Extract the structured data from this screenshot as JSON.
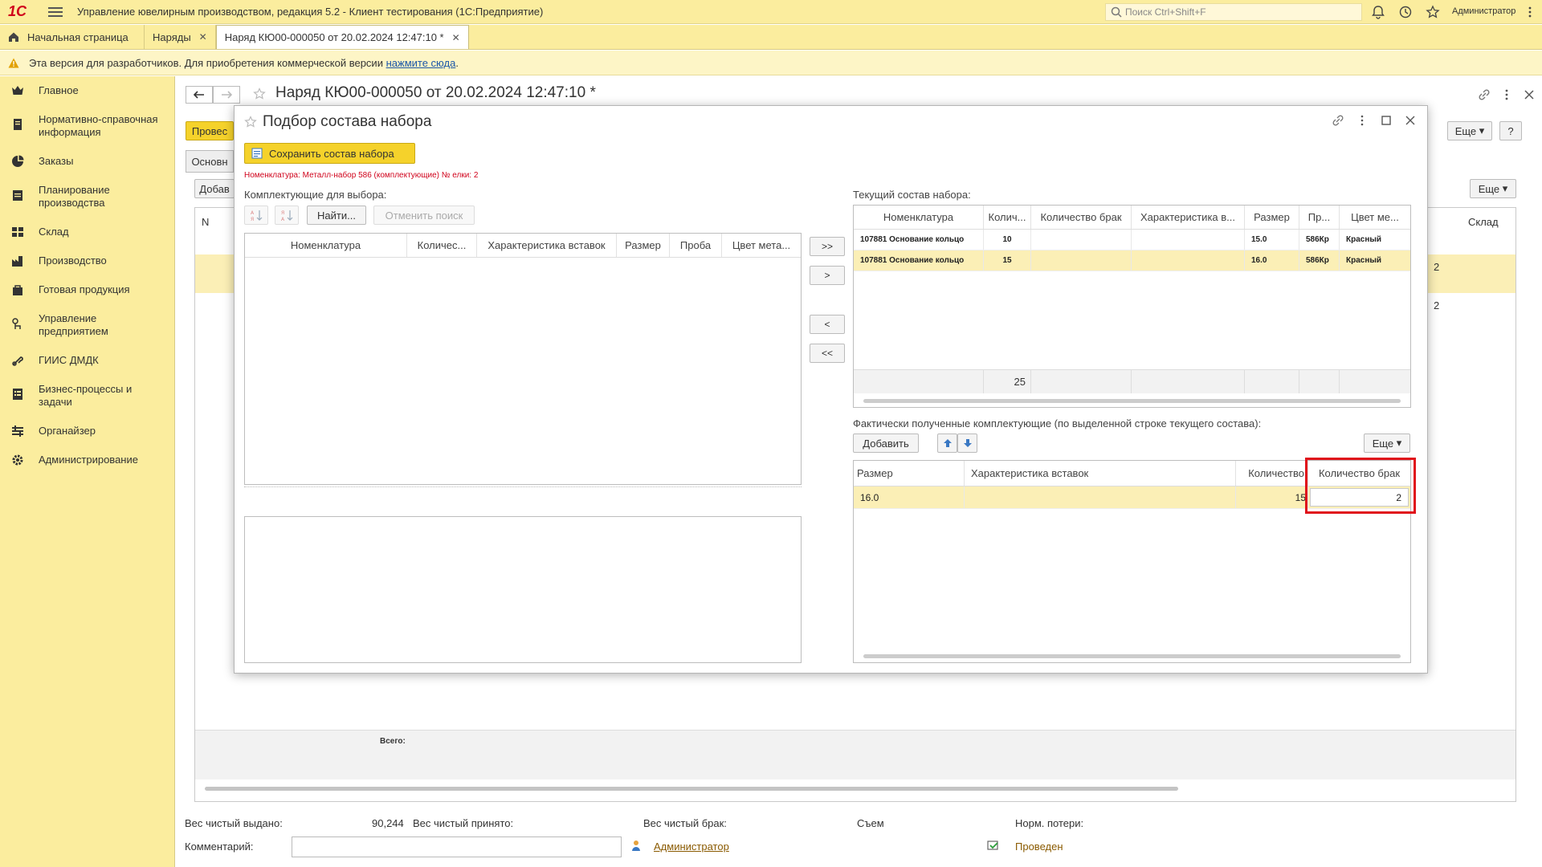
{
  "titlebar": {
    "app_title": "Управление ювелирным производством, редакция 5.2  - Клиент тестирования (1С:Предприятие)",
    "logo_text": "1С",
    "search_placeholder": "Поиск Ctrl+Shift+F",
    "user": "Администратор"
  },
  "tabs": {
    "home": "Начальная страница",
    "naryady": "Наряды",
    "active": "Наряд КЮ00-000050 от 20.02.2024 12:47:10 *"
  },
  "warning": {
    "text": "Эта версия для разработчиков. Для приобретения коммерческой версии ",
    "link": "нажмите сюда",
    "after": "."
  },
  "sidebar": {
    "items": [
      {
        "label": "Главное",
        "icon": "crown-icon"
      },
      {
        "label": "Нормативно-справочная информация",
        "icon": "reference-icon"
      },
      {
        "label": "Заказы",
        "icon": "orders-pie-icon"
      },
      {
        "label": "Планирование производства",
        "icon": "planning-icon"
      },
      {
        "label": "Склад",
        "icon": "warehouse-icon"
      },
      {
        "label": "Производство",
        "icon": "production-icon"
      },
      {
        "label": "Готовая продукция",
        "icon": "finished-goods-icon"
      },
      {
        "label": "Управление предприятием",
        "icon": "enterprise-icon"
      },
      {
        "label": "ГИИС ДМДК",
        "icon": "giis-icon"
      },
      {
        "label": "Бизнес-процессы и задачи",
        "icon": "business-process-icon"
      },
      {
        "label": "Органайзер",
        "icon": "organizer-icon"
      },
      {
        "label": "Администрирование",
        "icon": "admin-gear-icon"
      }
    ]
  },
  "document": {
    "title": "Наряд КЮ00-000050 от 20.02.2024 12:47:10 *",
    "post_button": "Провес",
    "tab_main": "Основн",
    "add_button": "Добав",
    "more_button": "Еще",
    "more_button2": "Еще",
    "help_button": "?",
    "col_n": "N",
    "col_sklad": "Склад",
    "row_values": [
      "2",
      "2"
    ],
    "total_label": "Всего:",
    "footer": {
      "ves_vydano_label": "Вес чистый выдано:",
      "ves_vydano_value": "90,244",
      "ves_prinyato_label": "Вес чистый принято:",
      "ves_brak_label": "Вес чистый брак:",
      "sem_label": "Съем",
      "norm_label": "Норм. потери:",
      "comment_label": "Комментарий:",
      "author": "Администратор",
      "status": "Проведен"
    }
  },
  "modal": {
    "title": "Подбор состава набора",
    "save_button": "Сохранить состав набора",
    "red_note": "Номенклатура: Металл-набор 586 (комплектующие)   № елки: 2",
    "left_label": "Комплектующие для выбора:",
    "find_button": "Найти...",
    "cancel_search_button": "Отменить поиск",
    "left_columns": [
      "Номенклатура",
      "Количес...",
      "Характеристика вставок",
      "Размер",
      "Проба",
      "Цвет мета..."
    ],
    "move_buttons": [
      ">>",
      ">",
      "<",
      "<<"
    ],
    "current_label": "Текущий состав набора:",
    "current_columns": [
      "Номенклатура",
      "Колич...",
      "Количество брак",
      "Характеристика в...",
      "Размер",
      "Пр...",
      "Цвет ме..."
    ],
    "current_rows": [
      [
        "107881 Основание кольцо",
        "10",
        "",
        "",
        "15.0",
        "586Кр",
        "Красный"
      ],
      [
        "107881 Основание кольцо",
        "15",
        "",
        "",
        "16.0",
        "586Кр",
        "Красный"
      ]
    ],
    "current_total": "25",
    "actual_label": "Фактически полученные комплектующие (по выделенной строке текущего состава):",
    "add_button": "Добавить",
    "more_button": "Еще",
    "actual_columns": [
      "Размер",
      "Характеристика вставок",
      "Количество",
      "Количество брак"
    ],
    "actual_rows": [
      [
        "16.0",
        "",
        "15",
        "2"
      ]
    ]
  }
}
